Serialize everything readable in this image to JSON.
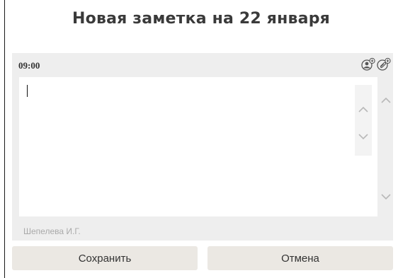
{
  "dialog": {
    "title": "Новая заметка на 22 января"
  },
  "note": {
    "time": "09:00",
    "text": "",
    "author": "Шепелева И.Г."
  },
  "toolbar": {
    "icons": [
      "add-user-icon",
      "attach-icon"
    ]
  },
  "actions": {
    "save_label": "Сохранить",
    "cancel_label": "Отмена"
  },
  "colors": {
    "panel_bg": "#eeeeee",
    "button_bg": "#ebe8e3",
    "title_text": "#3a3a3a",
    "muted_text": "#aaaaaa"
  }
}
